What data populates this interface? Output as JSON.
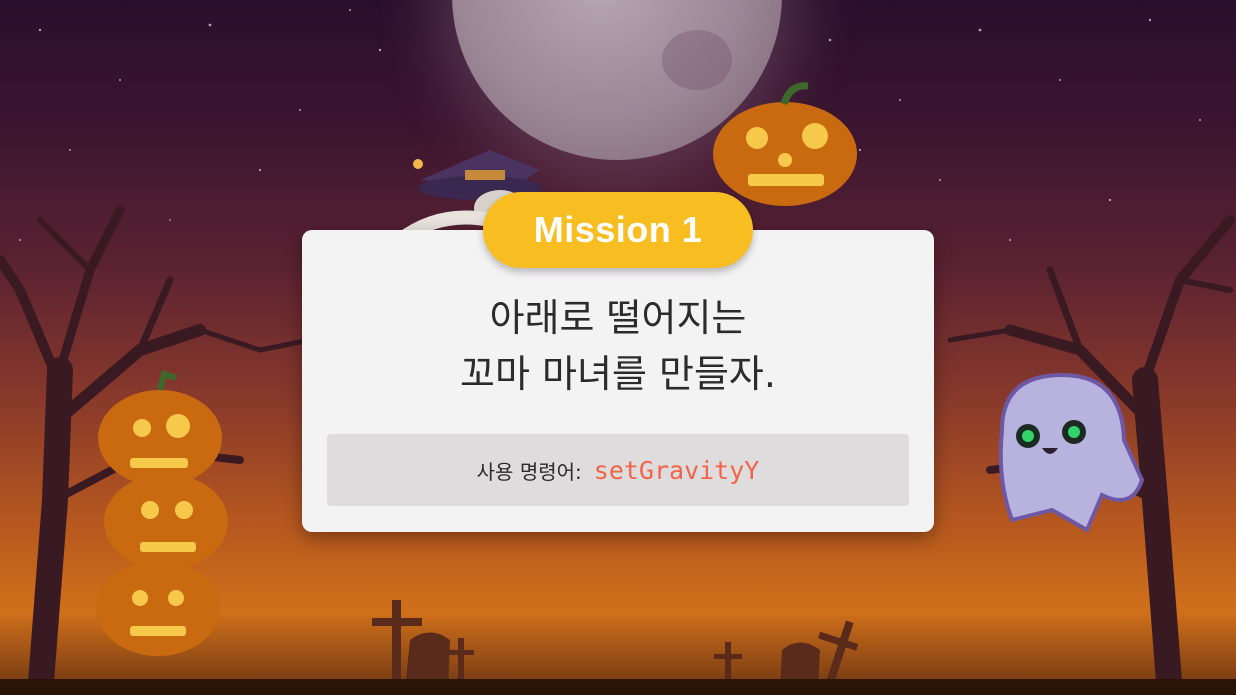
{
  "mission_badge": "Mission 1",
  "mission_title": {
    "line1": "아래로 떨어지는",
    "line2": "꼬마 마녀를 만들자."
  },
  "command": {
    "label": "사용 명령어:",
    "code": "setGravityY"
  },
  "colors": {
    "badge": "#f8bd21",
    "card": "#f4f3f4",
    "command_box": "#dedcdc",
    "code_text": "#f2634a"
  },
  "icons": [
    "moon",
    "pumpkin",
    "witch",
    "ghost",
    "dead-tree",
    "grave-cross"
  ]
}
